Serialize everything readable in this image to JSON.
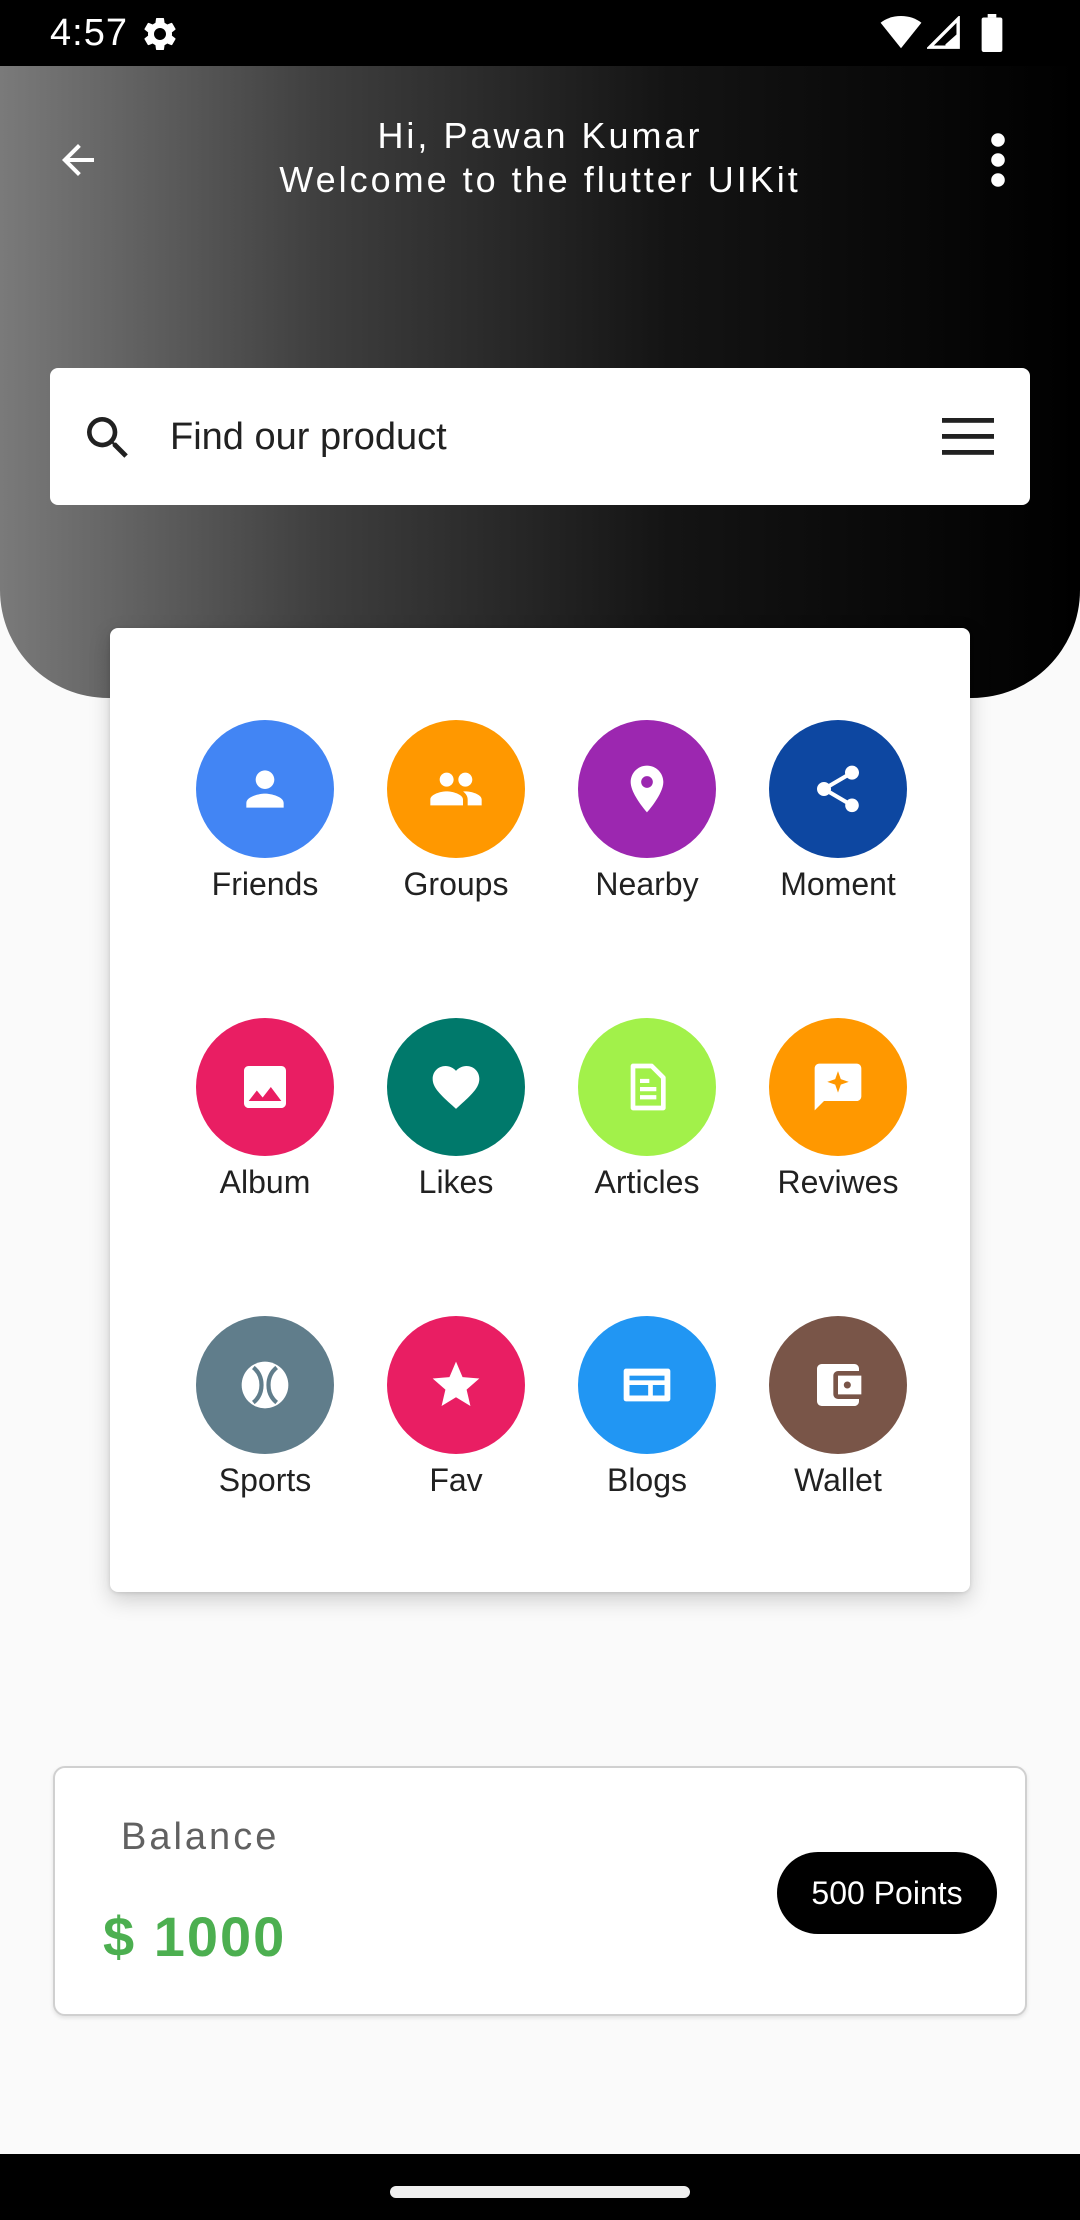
{
  "status_bar": {
    "time": "4:57",
    "icons": [
      "gear-icon",
      "wifi-icon",
      "signal-icon",
      "battery-icon"
    ]
  },
  "header": {
    "greeting": "Hi, Pawan Kumar",
    "subtitle": "Welcome to the flutter UIKit",
    "back_icon": "arrow-back-icon",
    "menu_icon": "more-vert-icon"
  },
  "search": {
    "placeholder": "Find our product",
    "value": "",
    "search_icon": "search-icon",
    "menu_icon": "hamburger-icon"
  },
  "features": [
    {
      "label": "Friends",
      "icon": "person-icon",
      "color": "#4285f4"
    },
    {
      "label": "Groups",
      "icon": "group-icon",
      "color": "#ff9800"
    },
    {
      "label": "Nearby",
      "icon": "location-pin-icon",
      "color": "#9c27b0"
    },
    {
      "label": "Moment",
      "icon": "share-icon",
      "color": "#0d47a1"
    },
    {
      "label": "Album",
      "icon": "image-icon",
      "color": "#e91e63"
    },
    {
      "label": "Likes",
      "icon": "heart-icon",
      "color": "#00796b"
    },
    {
      "label": "Articles",
      "icon": "article-icon",
      "color": "#a2f14a"
    },
    {
      "label": "Reviwes",
      "icon": "rate-review-icon",
      "color": "#ff9800"
    },
    {
      "label": "Sports",
      "icon": "sports-ball-icon",
      "color": "#607d8b"
    },
    {
      "label": "Fav",
      "icon": "star-icon",
      "color": "#e91e63"
    },
    {
      "label": "Blogs",
      "icon": "blog-icon",
      "color": "#2196f3"
    },
    {
      "label": "Wallet",
      "icon": "wallet-icon",
      "color": "#795548"
    }
  ],
  "balance": {
    "label": "Balance",
    "amount": "$ 1000",
    "amount_color": "#4caf50",
    "points_label": "500 Points"
  },
  "colors": {
    "header_gradient_start": "#7a7a7a",
    "header_gradient_end": "#000000",
    "background": "#fafafa"
  }
}
